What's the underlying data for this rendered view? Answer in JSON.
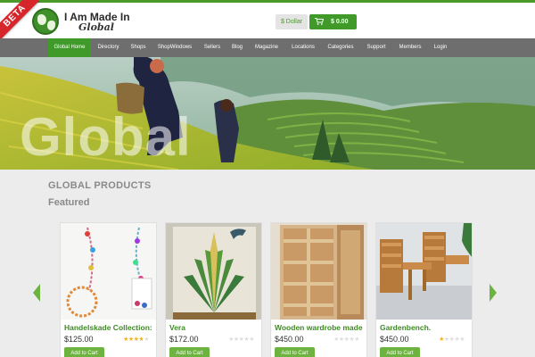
{
  "header": {
    "ribbon": "BETA",
    "logo_line1": "I Am Made In",
    "logo_line2": "Global",
    "currency_label": "$ Dollar",
    "cart_total": "$ 0.00"
  },
  "nav": {
    "items": [
      {
        "label": "Global Home",
        "active": true
      },
      {
        "label": "Directory"
      },
      {
        "label": "Shops"
      },
      {
        "label": "ShopWindows"
      },
      {
        "label": "Sellers"
      },
      {
        "label": "Blog"
      },
      {
        "label": "Magazine"
      },
      {
        "label": "Locations"
      },
      {
        "label": "Categories"
      },
      {
        "label": "Support"
      },
      {
        "label": "Members"
      },
      {
        "label": "Login"
      }
    ]
  },
  "hero": {
    "word": "Global"
  },
  "section": {
    "title": "GLOBAL PRODUCTS",
    "subtitle": "Featured"
  },
  "products": [
    {
      "name": "Handelskade Collection:",
      "price": "$125.00",
      "rating": 4,
      "add_label": "Add to Cart"
    },
    {
      "name": "Vera",
      "price": "$172.00",
      "rating": 0,
      "add_label": "Add to Cart"
    },
    {
      "name": "Wooden wardrobe made",
      "price": "$450.00",
      "rating": 0,
      "add_label": "Add to Cart"
    },
    {
      "name": "Gardenbench.",
      "price": "$450.00",
      "rating": 1,
      "add_label": "Add to Cart"
    }
  ],
  "icons": {
    "globe": "globe-logo-icon",
    "cart": "cart-icon",
    "prev": "arrow-left-icon",
    "next": "arrow-right-icon",
    "star": "star-icon"
  },
  "colors": {
    "brand_green": "#3f9a2a",
    "accent_green": "#6cb33f",
    "nav_gray": "#6e6e6e",
    "beta_red": "#d6262b",
    "star_gold": "#f2b21b"
  }
}
